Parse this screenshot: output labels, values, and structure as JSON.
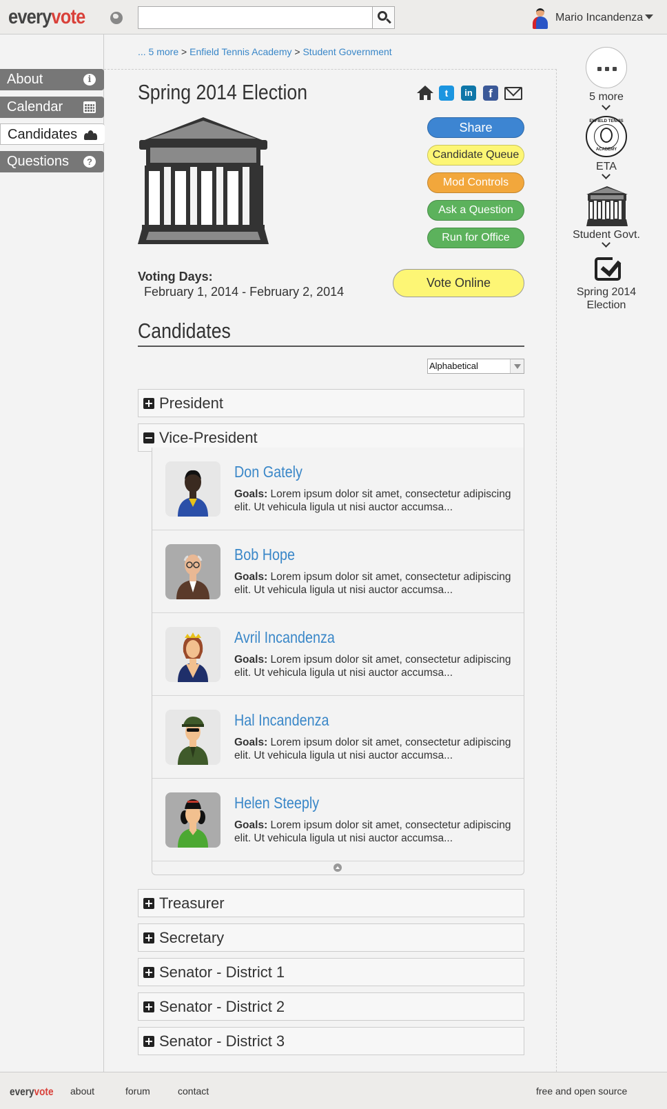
{
  "header": {
    "logo_part1": "every",
    "logo_part2": "vote",
    "search_value": "",
    "user_name": "Mario Incandenza"
  },
  "nav": {
    "items": [
      {
        "label": "About",
        "icon": "info-icon"
      },
      {
        "label": "Calendar",
        "icon": "calendar-icon"
      },
      {
        "label": "Candidates",
        "icon": "group-icon",
        "active": true
      },
      {
        "label": "Questions",
        "icon": "help-icon"
      }
    ]
  },
  "breadcrumb": {
    "more": "... 5 more",
    "sep": ">",
    "items": [
      "Enfield Tennis Academy",
      "Student Government"
    ]
  },
  "election": {
    "title": "Spring 2014 Election",
    "voting_label": "Voting Days:",
    "voting_dates": "February 1, 2014 - February 2, 2014"
  },
  "actions": {
    "share": "Share",
    "queue": "Candidate Queue",
    "mod": "Mod Controls",
    "ask": "Ask a Question",
    "run": "Run for Office",
    "vote": "Vote Online"
  },
  "candidates_section": {
    "title": "Candidates",
    "sort_selected": "Alphabetical"
  },
  "offices": [
    {
      "label": "President",
      "expanded": false
    },
    {
      "label": "Vice-President",
      "expanded": true
    },
    {
      "label": "Treasurer",
      "expanded": false
    },
    {
      "label": "Secretary",
      "expanded": false
    },
    {
      "label": "Senator - District 1",
      "expanded": false
    },
    {
      "label": "Senator - District 2",
      "expanded": false
    },
    {
      "label": "Senator - District 3",
      "expanded": false
    }
  ],
  "candidates": [
    {
      "name": "Don Gately",
      "goals_label": "Goals:",
      "goals": "Lorem ipsum dolor sit amet, consectetur adipiscing elit. Ut vehicula ligula ut nisi auctor accumsa..."
    },
    {
      "name": "Bob Hope",
      "goals_label": "Goals:",
      "goals": "Lorem ipsum dolor sit amet, consectetur adipiscing elit. Ut vehicula ligula ut nisi auctor accumsa..."
    },
    {
      "name": "Avril Incandenza",
      "goals_label": "Goals:",
      "goals": "Lorem ipsum dolor sit amet, consectetur adipiscing elit. Ut vehicula ligula ut nisi auctor accumsa..."
    },
    {
      "name": "Hal Incandenza",
      "goals_label": "Goals:",
      "goals": "Lorem ipsum dolor sit amet, consectetur adipiscing elit. Ut vehicula ligula ut nisi auctor accumsa..."
    },
    {
      "name": "Helen Steeply",
      "goals_label": "Goals:",
      "goals": "Lorem ipsum dolor sit amet, consectetur adipiscing elit. Ut vehicula ligula ut nisi auctor accumsa..."
    }
  ],
  "hierarchy": {
    "more_label": "5 more",
    "eta_label": "ETA",
    "eta_logo_top": "ENFIELD TENNIS",
    "eta_logo_bottom": "ACADEMY",
    "govt_label": "Student Govt.",
    "election_label": "Spring 2014 Election"
  },
  "social": {
    "twitter": "t",
    "linkedin": "in",
    "facebook": "f"
  },
  "footer": {
    "logo_part1": "every",
    "logo_part2": "vote",
    "about": "about",
    "forum": "forum",
    "contact": "contact",
    "tagline": "free and open source"
  },
  "colors": {
    "accent_red": "#d9413a",
    "link_blue": "#3a87c8",
    "share_blue": "#3d85d2",
    "yellow": "#fdf675",
    "orange": "#f2a73c",
    "green": "#5cb25c"
  }
}
